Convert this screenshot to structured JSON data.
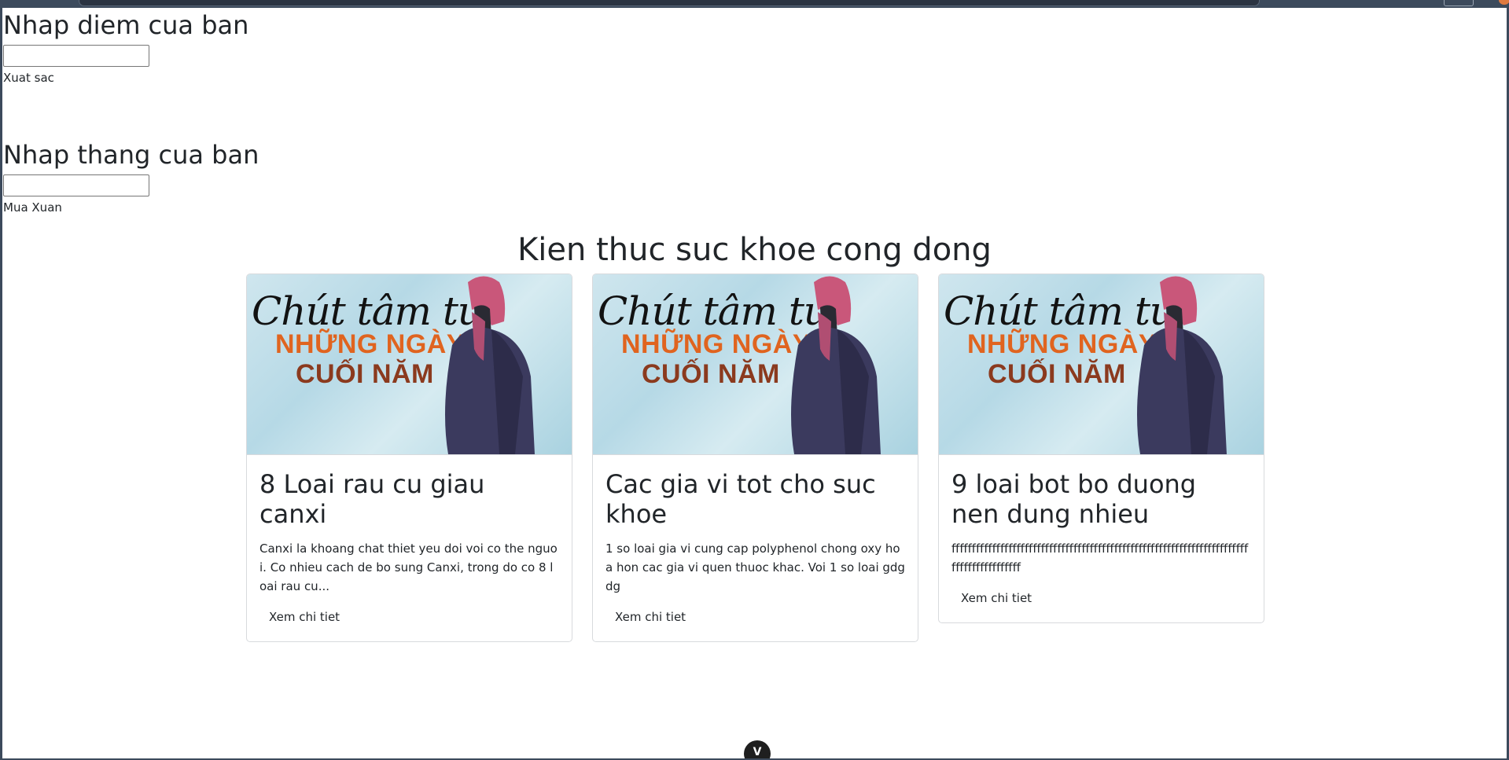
{
  "form_score": {
    "heading": "Nhap diem cua ban",
    "input_value": "",
    "result": "Xuat sac"
  },
  "form_month": {
    "heading": "Nhap thang cua ban",
    "input_value": "",
    "result": "Mua Xuan"
  },
  "section": {
    "title": "Kien thuc suc khoe cong dong"
  },
  "card_image": {
    "script_text": "Chút tâm tư",
    "line1": "NHỮNG NGÀY",
    "line2": "CUỐI NĂM"
  },
  "cards": [
    {
      "title": "8 Loai rau cu giau canxi",
      "text": "Canxi la khoang chat thiet yeu doi voi co the nguoi. Co nhieu cach de bo sung Canxi, trong do co 8 loai rau cu...",
      "link": "Xem chi tiet"
    },
    {
      "title": "Cac gia vi tot cho suc khoe",
      "text": "1 so loai gia vi cung cap polyphenol chong oxy hoa hon cac gia vi quen thuoc khac. Voi 1 so loai gdgdg",
      "link": "Xem chi tiet"
    },
    {
      "title": "9 loai bot bo duong nen dung nhieu",
      "text": "ffffffffffffffffffffffffffffffffffffffffffffffffffffffffffffffffffffffffffffffffffffffffff",
      "link": "Xem chi tiet"
    }
  ],
  "bottom_badge": {
    "label": "V"
  }
}
